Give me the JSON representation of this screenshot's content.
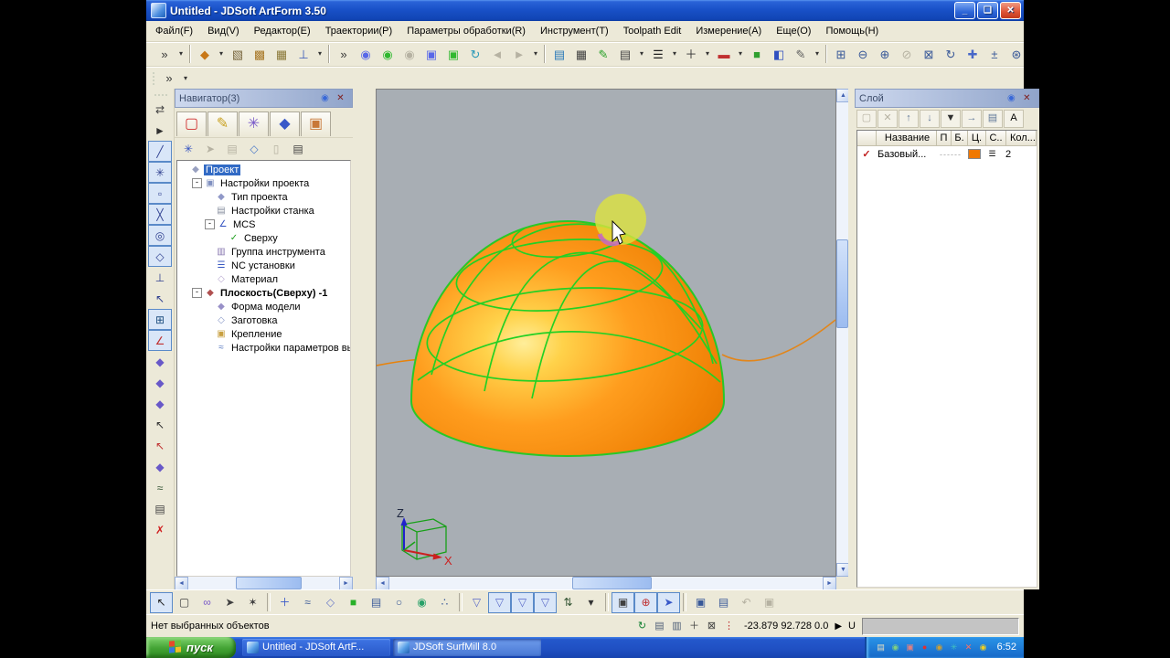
{
  "window": {
    "title": "Untitled - JDSoft ArtForm 3.50",
    "controls": [
      {
        "n": "minimize-button",
        "g": "_",
        "x": "wbtn"
      },
      {
        "n": "restore-button",
        "g": "❏",
        "x": "wbtn"
      },
      {
        "n": "close-button",
        "g": "✕",
        "x": "close"
      }
    ]
  },
  "menu": {
    "items": [
      {
        "label": "Файл(F)"
      },
      {
        "label": "Вид(V)"
      },
      {
        "label": "Редактор(E)"
      },
      {
        "label": "Траектории(P)"
      },
      {
        "label": "Параметры обработки(R)"
      },
      {
        "label": "Инструмент(T)"
      },
      {
        "label": "Toolpath Edit"
      },
      {
        "label": "Измерение(A)"
      },
      {
        "label": "Еще(O)"
      },
      {
        "label": "Помощь(H)"
      }
    ]
  },
  "toolbar_top": {
    "g0": [
      {
        "n": "overflow-chevron-icon",
        "g": "»",
        "c": "#333"
      },
      {
        "n": "dropdown-arrow-icon",
        "g": "▾",
        "x": "dd"
      }
    ],
    "g1": [
      {
        "n": "render-mode-icon",
        "g": "◆",
        "c": "#c87818"
      },
      {
        "n": "dropdown-arrow-icon",
        "g": "▾",
        "x": "dd"
      },
      {
        "n": "wireframe-view-icon",
        "g": "▧",
        "c": "#7a6840"
      },
      {
        "n": "shaded-view-icon",
        "g": "▩",
        "c": "#a87828"
      },
      {
        "n": "combined-view-icon",
        "g": "▦",
        "c": "#8a7838"
      },
      {
        "n": "view-orientation-icon",
        "g": "⊥",
        "c": "#3858b8"
      },
      {
        "n": "dropdown-arrow-icon",
        "g": "▾",
        "x": "dd"
      }
    ],
    "g2": [
      {
        "n": "overflow-chevron-icon",
        "g": "»",
        "c": "#333"
      },
      {
        "n": "light-blue-icon",
        "g": "◉",
        "c": "#5868e8"
      },
      {
        "n": "light-green-icon",
        "g": "◉",
        "c": "#30b830"
      },
      {
        "n": "light-off-icon",
        "g": "◉",
        "d": true
      },
      {
        "n": "marquee-light-blue-icon",
        "g": "▣",
        "c": "#5868e8"
      },
      {
        "n": "marquee-light-green-icon",
        "g": "▣",
        "c": "#30b830"
      },
      {
        "n": "refresh-lights-icon",
        "g": "↻",
        "c": "#2898b8"
      },
      {
        "n": "back-icon",
        "g": "◄",
        "d": true
      },
      {
        "n": "forward-icon",
        "g": "►",
        "d": true
      },
      {
        "n": "dropdown-arrow-icon",
        "g": "▾",
        "x": "dd"
      }
    ],
    "g3": [
      {
        "n": "pages-icon",
        "g": "▤",
        "c": "#2878b8"
      },
      {
        "n": "grid-values-icon",
        "g": "▦",
        "c": "#404040"
      },
      {
        "n": "pick-pen-icon",
        "g": "✎",
        "c": "#28a028"
      },
      {
        "n": "table-icon",
        "g": "▤",
        "c": "#404040"
      },
      {
        "n": "dropdown-arrow-icon",
        "g": "▾",
        "x": "dd"
      },
      {
        "n": "line-width-icon",
        "g": "☰",
        "c": "#202020"
      },
      {
        "n": "dropdown-arrow-icon",
        "g": "▾",
        "x": "dd"
      },
      {
        "n": "cross-marker-icon",
        "g": "＋",
        "c": "#303030"
      },
      {
        "n": "dropdown-arrow-icon",
        "g": "▾",
        "x": "dd"
      },
      {
        "n": "color-bars-icon",
        "g": "▬",
        "c": "#c03030"
      },
      {
        "n": "dropdown-arrow-icon",
        "g": "▾",
        "x": "dd"
      },
      {
        "n": "gradient-icon",
        "g": "■",
        "c": "#30a030"
      },
      {
        "n": "palette-icon",
        "g": "◧",
        "c": "#3050c0"
      },
      {
        "n": "color-picker-icon",
        "g": "✎",
        "c": "#606060"
      },
      {
        "n": "dropdown-arrow-icon",
        "g": "▾",
        "x": "dd"
      }
    ],
    "g4": [
      {
        "n": "zoom-window-icon",
        "g": "⊞",
        "c": "#385898"
      },
      {
        "n": "zoom-out-icon",
        "g": "⊖",
        "c": "#385898"
      },
      {
        "n": "zoom-in-icon",
        "g": "⊕",
        "c": "#385898"
      },
      {
        "n": "zoom-named-icon",
        "g": "⊘",
        "d": true
      },
      {
        "n": "zoom-extents-icon",
        "g": "⊠",
        "c": "#385898"
      },
      {
        "n": "zoom-rotate-icon",
        "g": "↻",
        "c": "#385898"
      },
      {
        "n": "pan-icon",
        "g": "✚",
        "c": "#4868c8"
      },
      {
        "n": "zoom-plusminus-icon",
        "g": "±",
        "c": "#385898"
      },
      {
        "n": "orbit-icon",
        "g": "⊛",
        "c": "#385898"
      }
    ]
  },
  "strip": {
    "icons": [
      {
        "n": "overflow-chevron-icon",
        "g": "»",
        "c": "#333"
      },
      {
        "n": "dropdown-arrow-icon",
        "g": "▾",
        "x": "dd"
      }
    ]
  },
  "left_toolbar": {
    "icons": [
      {
        "n": "swap-arrows-icon",
        "g": "⇄",
        "c": "#404040"
      },
      {
        "n": "play-icon",
        "g": "►",
        "c": "#303030"
      },
      {
        "n": "draw-line-icon",
        "g": "╱",
        "c": "#304090",
        "p": true
      },
      {
        "n": "polyline-icon",
        "g": "✳",
        "c": "#304090",
        "p": true
      },
      {
        "n": "midpoint-icon",
        "g": "▫",
        "c": "#304090",
        "p": true
      },
      {
        "n": "intersection-icon",
        "g": "╳",
        "c": "#304090",
        "p": true
      },
      {
        "n": "concentric-icon",
        "g": "◎",
        "c": "#304090",
        "p": true
      },
      {
        "n": "handle-circle-icon",
        "g": "◇",
        "c": "#304090",
        "p": true
      },
      {
        "n": "perpendicular-icon",
        "g": "⊥",
        "c": "#304090"
      },
      {
        "n": "tangent-icon",
        "g": "↖",
        "c": "#304090"
      },
      {
        "n": "grid-sphere-icon",
        "g": "⊞",
        "c": "#205080",
        "p": true
      },
      {
        "n": "axes-xyz-icon",
        "g": "∠",
        "c": "#c03030",
        "p": true
      },
      {
        "n": "surface-a-icon",
        "g": "◆",
        "c": "#6858c8"
      },
      {
        "n": "surface-b-icon",
        "g": "◆",
        "c": "#6858c8"
      },
      {
        "n": "surface-c-icon",
        "g": "◆",
        "c": "#6858c8"
      },
      {
        "n": "pick-add-icon",
        "g": "↖",
        "c": "#303030"
      },
      {
        "n": "pick-remove-icon",
        "g": "↖",
        "c": "#c03030"
      },
      {
        "n": "surface-pick-icon",
        "g": "◆",
        "c": "#6858c8"
      },
      {
        "n": "curve-pick-icon",
        "g": "≈",
        "c": "#305030"
      },
      {
        "n": "notes-icon",
        "g": "▤",
        "c": "#404040"
      },
      {
        "n": "delete-icon",
        "g": "✗",
        "c": "#d02020"
      }
    ]
  },
  "navigator": {
    "title": "Навигатор(3)",
    "header_icons": [
      {
        "n": "dock-icon",
        "g": "◉",
        "c": "#3868d8"
      },
      {
        "n": "close-icon",
        "g": "✕",
        "c": "#802020"
      }
    ],
    "tabs": [
      {
        "n": "tab-frame-tool-icon",
        "g": "▢",
        "c": "#d03030"
      },
      {
        "n": "tab-draw-tool-icon",
        "g": "✎",
        "c": "#c8a020"
      },
      {
        "n": "tab-art-model-icon",
        "g": "✳",
        "c": "#7858c8"
      },
      {
        "n": "tab-relief-icon",
        "g": "◆",
        "c": "#3858c8"
      },
      {
        "n": "tab-cam-icon",
        "g": "▣",
        "c": "#c87838"
      }
    ],
    "tools": [
      {
        "n": "magic-brush-icon",
        "g": "✳",
        "c": "#3050c0"
      },
      {
        "n": "runner-icon",
        "g": "➤",
        "d": true
      },
      {
        "n": "table-icon",
        "g": "▤",
        "d": true
      },
      {
        "n": "surface-icon",
        "g": "◇",
        "c": "#4878c8"
      },
      {
        "n": "pin-icon",
        "g": "▯",
        "d": true
      },
      {
        "n": "report-icon",
        "g": "▤",
        "c": "#404040"
      }
    ],
    "tree": [
      {
        "lv": 0,
        "g": "◆",
        "c": "#98a0c0",
        "label": "Проект",
        "sel": true,
        "icon": "project-icon"
      },
      {
        "lv": 1,
        "g": "▣",
        "c": "#8090c0",
        "label": "Настройки проекта",
        "exp": true,
        "icon": "project-settings-icon"
      },
      {
        "lv": 2,
        "g": "◆",
        "c": "#9098c8",
        "label": "Тип проекта",
        "icon": "project-type-icon"
      },
      {
        "lv": 2,
        "g": "▤",
        "c": "#8890a0",
        "label": "Настройки станка",
        "icon": "machine-settings-icon"
      },
      {
        "lv": 2,
        "g": "∠",
        "c": "#3050c0",
        "label": "MCS",
        "exp": true,
        "icon": "mcs-icon"
      },
      {
        "lv": 3,
        "g": "✓",
        "c": "#20a020",
        "label": "Сверху",
        "icon": "view-top-icon"
      },
      {
        "lv": 2,
        "g": "▥",
        "c": "#8878b0",
        "label": "Группа инструмента",
        "icon": "tool-group-icon"
      },
      {
        "lv": 2,
        "g": "☰",
        "c": "#3858c0",
        "label": "NC установки",
        "icon": "nc-settings-icon"
      },
      {
        "lv": 2,
        "g": "◇",
        "c": "#b8a8d0",
        "label": "Материал",
        "icon": "material-icon"
      },
      {
        "lv": 1,
        "g": "◆",
        "c": "#b05050",
        "label": "Плоскость(Сверху) -1",
        "exp": true,
        "bold": true,
        "icon": "plane-icon"
      },
      {
        "lv": 2,
        "g": "◆",
        "c": "#9890c8",
        "label": "Форма модели",
        "icon": "model-shape-icon"
      },
      {
        "lv": 2,
        "g": "◇",
        "c": "#8898c8",
        "label": "Заготовка",
        "icon": "stock-icon"
      },
      {
        "lv": 2,
        "g": "▣",
        "c": "#c8a040",
        "label": "Крепление",
        "icon": "fixture-icon"
      },
      {
        "lv": 2,
        "g": "≈",
        "c": "#5878c0",
        "label": "Настройки параметров вых",
        "icon": "output-params-icon"
      }
    ]
  },
  "viewport": {
    "axis_z": "Z",
    "axis_x": "X"
  },
  "layers": {
    "title": "Слой",
    "header_icons": [
      {
        "n": "dock-icon",
        "g": "◉",
        "c": "#3868d8"
      },
      {
        "n": "close-icon",
        "g": "✕",
        "c": "#802020"
      }
    ],
    "tools": [
      {
        "n": "new-layer-icon",
        "g": "▢",
        "d": true
      },
      {
        "n": "delete-layer-icon",
        "g": "✕",
        "d": true
      },
      {
        "n": "move-up-icon",
        "g": "↑",
        "c": "#607898"
      },
      {
        "n": "move-down-icon",
        "g": "↓",
        "c": "#607898"
      },
      {
        "n": "filter-icon",
        "g": "▼",
        "c": "#303030"
      },
      {
        "n": "move-to-layer-icon",
        "g": "→",
        "c": "#607898"
      },
      {
        "n": "copy-layer-icon",
        "g": "▤",
        "c": "#607898"
      },
      {
        "n": "text-style-icon",
        "g": "A",
        "c": "#000"
      }
    ],
    "columns": [
      "",
      "Название",
      "П",
      "Б.",
      "Ц.",
      "С..",
      "Кол..."
    ],
    "rows": [
      {
        "check": "✓",
        "name": "Базовый...",
        "line": "------",
        "color": "#f07800",
        "pattern": "☰",
        "count": "2"
      }
    ]
  },
  "toolbar_bottom": {
    "b1": [
      {
        "n": "select-icon",
        "g": "↖",
        "c": "#202020",
        "p": true
      },
      {
        "n": "marquee-select-icon",
        "g": "▢",
        "c": "#404040"
      },
      {
        "n": "chain-select-icon",
        "g": "∞",
        "c": "#7858c8"
      },
      {
        "n": "curve-select-icon",
        "g": "➤",
        "c": "#404040"
      },
      {
        "n": "star-select-icon",
        "g": "✶",
        "c": "#404040"
      }
    ],
    "b2": [
      {
        "n": "add-point-icon",
        "g": "＋",
        "c": "#3858c8"
      },
      {
        "n": "pick-curve-icon",
        "g": "≈",
        "c": "#385898"
      },
      {
        "n": "pick-surface-icon",
        "g": "◇",
        "c": "#6878c8"
      },
      {
        "n": "pick-region-icon",
        "g": "■",
        "c": "#28b028"
      },
      {
        "n": "pick-solid-icon",
        "g": "▤",
        "c": "#385898"
      },
      {
        "n": "pick-circle-icon",
        "g": "○",
        "c": "#385898"
      },
      {
        "n": "pick-dot-icon",
        "g": "◉",
        "c": "#28a068"
      },
      {
        "n": "pick-cloud-icon",
        "g": "∴",
        "c": "#385898"
      }
    ],
    "b3": [
      {
        "n": "filter-funnel-icon",
        "g": "▽",
        "c": "#5868c8"
      },
      {
        "n": "filter-top-icon",
        "g": "▽",
        "c": "#5868c8",
        "p": true
      },
      {
        "n": "filter-mid-icon",
        "g": "▽",
        "c": "#5868c8",
        "p": true
      },
      {
        "n": "filter-bottom-icon",
        "g": "▽",
        "c": "#5868c8",
        "p": true
      },
      {
        "n": "sort-icon",
        "g": "⇅",
        "c": "#385838"
      },
      {
        "n": "dropdown-arrow-icon",
        "g": "▾",
        "x": "dd"
      }
    ],
    "b4": [
      {
        "n": "isolate-box-icon",
        "g": "▣",
        "c": "#404040",
        "p": true
      },
      {
        "n": "toggle-plus-icon",
        "g": "⊕",
        "c": "#c03030",
        "p": true
      },
      {
        "n": "goto-object-icon",
        "g": "➤",
        "c": "#3858c8",
        "p": true
      }
    ],
    "b5": [
      {
        "n": "select-marquee-cube-icon",
        "g": "▣",
        "c": "#385898"
      },
      {
        "n": "save-selection-icon",
        "g": "▤",
        "c": "#385898"
      },
      {
        "n": "undo-icon",
        "g": "↶",
        "d": true
      },
      {
        "n": "redo-box-icon",
        "g": "▣",
        "d": true
      }
    ]
  },
  "status": {
    "message": "Нет выбранных объектов",
    "icons": [
      {
        "n": "refresh-icon",
        "g": "↻",
        "c": "#108030"
      },
      {
        "n": "copy-icon",
        "g": "▤",
        "c": "#506078"
      },
      {
        "n": "stack-icon",
        "g": "▥",
        "c": "#506078"
      },
      {
        "n": "plus-icon",
        "g": "＋",
        "c": "#404040"
      },
      {
        "n": "no-snap-icon",
        "g": "⊠",
        "c": "#404040"
      },
      {
        "n": "track-icon",
        "g": "⋮",
        "c": "#c03030"
      }
    ],
    "coords": "-23.879 92.728 0.0",
    "play": "▶",
    "unit": "U"
  },
  "taskbar": {
    "start_label": "пуск",
    "tasks": [
      {
        "label": "Untitled - JDSoft ArtF..."
      },
      {
        "label": "JDSoft SurfMill 8.0",
        "active": true
      }
    ],
    "tray": [
      {
        "n": "media-film-icon",
        "g": "▤",
        "c": "#e8e0c0"
      },
      {
        "n": "chat-icon",
        "g": "◉",
        "c": "#80d080"
      },
      {
        "n": "pc-status-icon",
        "g": "▣",
        "c": "#e08080"
      },
      {
        "n": "security-shield-icon",
        "g": "●",
        "c": "#e03030"
      },
      {
        "n": "audio-device-icon",
        "g": "◉",
        "c": "#d0a030"
      },
      {
        "n": "network-users-icon",
        "g": "✳",
        "c": "#40c0c0"
      },
      {
        "n": "offline-icon",
        "g": "✕",
        "c": "#ff7060"
      },
      {
        "n": "volume-icon",
        "g": "◉",
        "c": "#f0d020"
      }
    ],
    "clock": "6:52"
  }
}
